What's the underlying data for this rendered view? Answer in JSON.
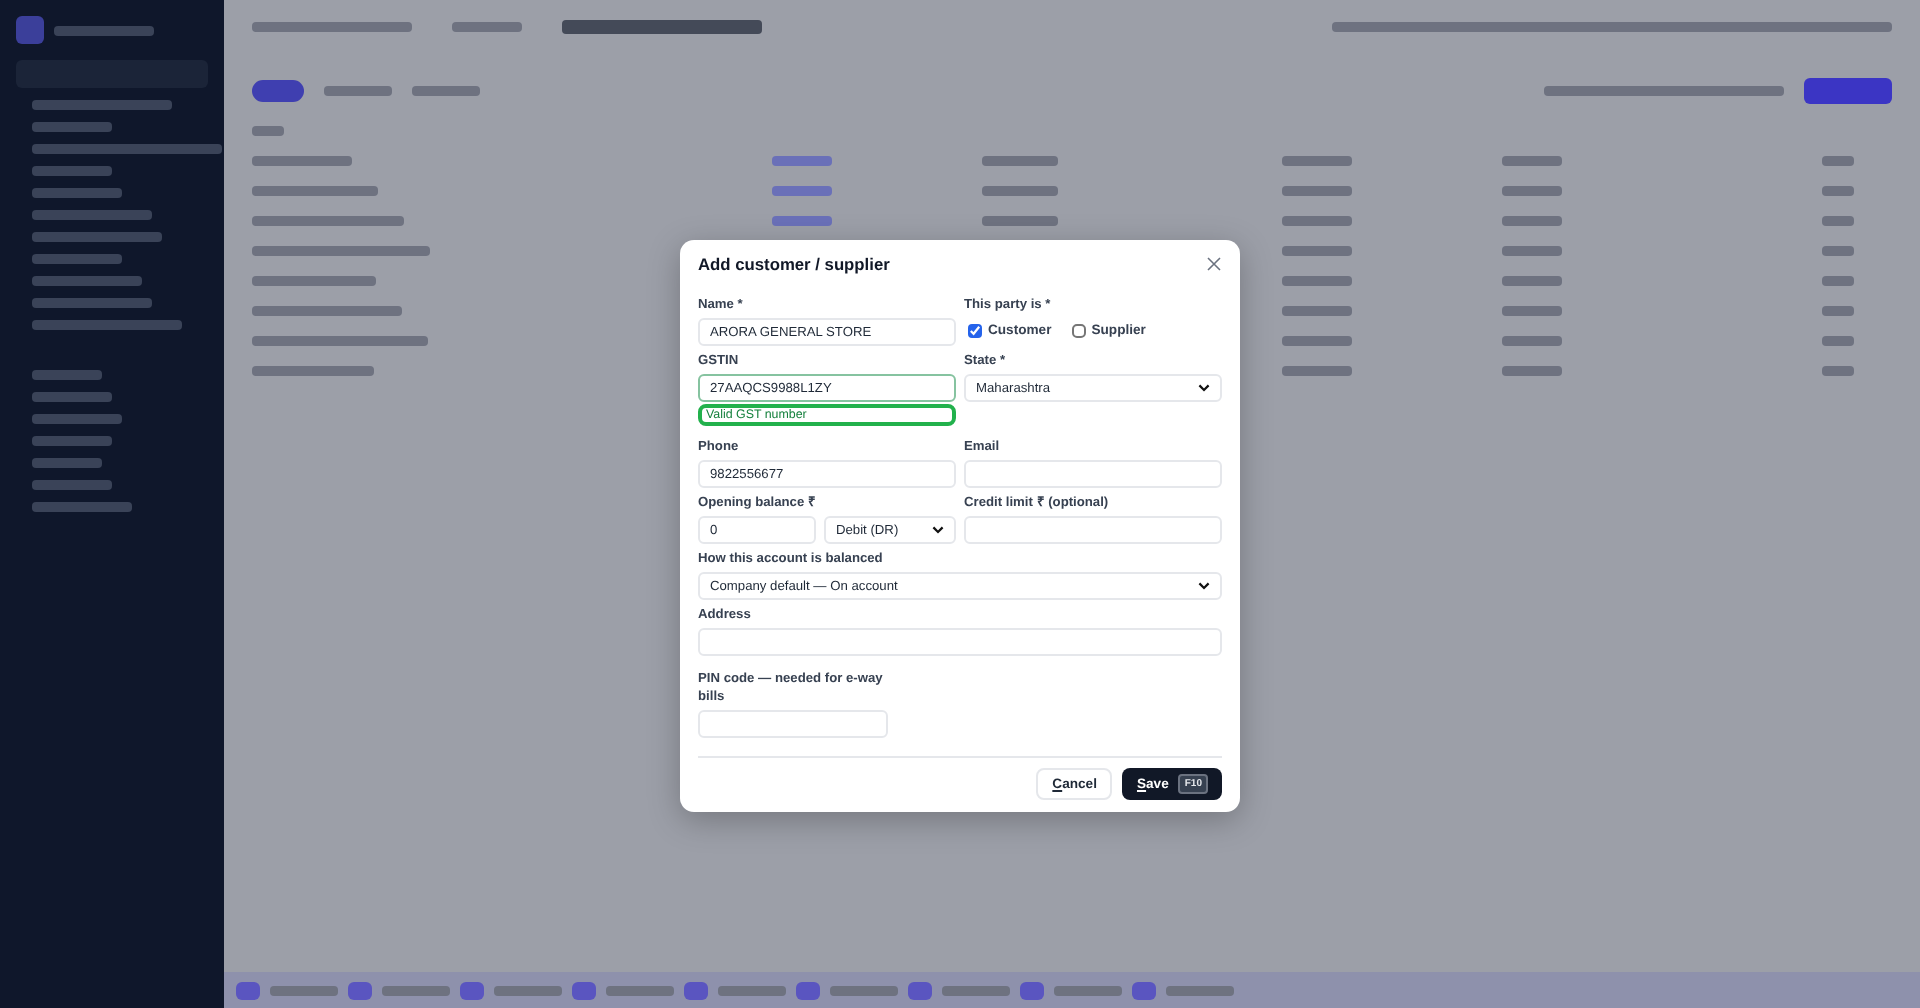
{
  "dialog": {
    "title": "Add customer / supplier",
    "name": {
      "label": "Name *",
      "value": "ARORA GENERAL STORE"
    },
    "party_type": {
      "label": "This party is *",
      "options": [
        {
          "label": "Customer",
          "checked": true
        },
        {
          "label": "Supplier",
          "checked": false
        }
      ]
    },
    "gstin": {
      "label": "GSTIN",
      "value": "27AAQCS9988L1ZY",
      "message": "Valid GST number",
      "valid": true
    },
    "state": {
      "label": "State *",
      "value": "Maharashtra"
    },
    "phone": {
      "label": "Phone",
      "value": "9822556677"
    },
    "email": {
      "label": "Email"
    },
    "opening_balance": {
      "label": "Opening balance ₹",
      "value": "0",
      "side": "Debit (DR)"
    },
    "credit_limit": {
      "label": "Credit limit ₹ (optional)"
    },
    "balancing": {
      "label": "How this account is balanced",
      "value": "Company default — On account"
    },
    "address": {
      "label": "Address"
    },
    "pin": {
      "label": "PIN code — needed for e-way bills"
    },
    "cancel": "Cancel",
    "save": "Save",
    "save_shortcut": "F10"
  }
}
